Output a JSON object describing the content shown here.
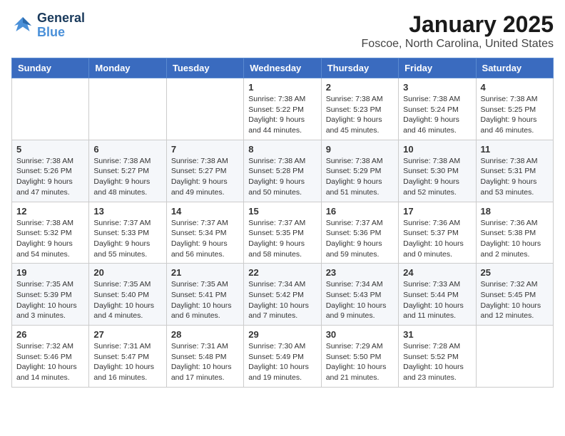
{
  "header": {
    "logo_line1": "General",
    "logo_line2": "Blue",
    "month_title": "January 2025",
    "location": "Foscoe, North Carolina, United States"
  },
  "days_of_week": [
    "Sunday",
    "Monday",
    "Tuesday",
    "Wednesday",
    "Thursday",
    "Friday",
    "Saturday"
  ],
  "weeks": [
    [
      {
        "day": "",
        "info": ""
      },
      {
        "day": "",
        "info": ""
      },
      {
        "day": "",
        "info": ""
      },
      {
        "day": "1",
        "info": "Sunrise: 7:38 AM\nSunset: 5:22 PM\nDaylight: 9 hours\nand 44 minutes."
      },
      {
        "day": "2",
        "info": "Sunrise: 7:38 AM\nSunset: 5:23 PM\nDaylight: 9 hours\nand 45 minutes."
      },
      {
        "day": "3",
        "info": "Sunrise: 7:38 AM\nSunset: 5:24 PM\nDaylight: 9 hours\nand 46 minutes."
      },
      {
        "day": "4",
        "info": "Sunrise: 7:38 AM\nSunset: 5:25 PM\nDaylight: 9 hours\nand 46 minutes."
      }
    ],
    [
      {
        "day": "5",
        "info": "Sunrise: 7:38 AM\nSunset: 5:26 PM\nDaylight: 9 hours\nand 47 minutes."
      },
      {
        "day": "6",
        "info": "Sunrise: 7:38 AM\nSunset: 5:27 PM\nDaylight: 9 hours\nand 48 minutes."
      },
      {
        "day": "7",
        "info": "Sunrise: 7:38 AM\nSunset: 5:27 PM\nDaylight: 9 hours\nand 49 minutes."
      },
      {
        "day": "8",
        "info": "Sunrise: 7:38 AM\nSunset: 5:28 PM\nDaylight: 9 hours\nand 50 minutes."
      },
      {
        "day": "9",
        "info": "Sunrise: 7:38 AM\nSunset: 5:29 PM\nDaylight: 9 hours\nand 51 minutes."
      },
      {
        "day": "10",
        "info": "Sunrise: 7:38 AM\nSunset: 5:30 PM\nDaylight: 9 hours\nand 52 minutes."
      },
      {
        "day": "11",
        "info": "Sunrise: 7:38 AM\nSunset: 5:31 PM\nDaylight: 9 hours\nand 53 minutes."
      }
    ],
    [
      {
        "day": "12",
        "info": "Sunrise: 7:38 AM\nSunset: 5:32 PM\nDaylight: 9 hours\nand 54 minutes."
      },
      {
        "day": "13",
        "info": "Sunrise: 7:37 AM\nSunset: 5:33 PM\nDaylight: 9 hours\nand 55 minutes."
      },
      {
        "day": "14",
        "info": "Sunrise: 7:37 AM\nSunset: 5:34 PM\nDaylight: 9 hours\nand 56 minutes."
      },
      {
        "day": "15",
        "info": "Sunrise: 7:37 AM\nSunset: 5:35 PM\nDaylight: 9 hours\nand 58 minutes."
      },
      {
        "day": "16",
        "info": "Sunrise: 7:37 AM\nSunset: 5:36 PM\nDaylight: 9 hours\nand 59 minutes."
      },
      {
        "day": "17",
        "info": "Sunrise: 7:36 AM\nSunset: 5:37 PM\nDaylight: 10 hours\nand 0 minutes."
      },
      {
        "day": "18",
        "info": "Sunrise: 7:36 AM\nSunset: 5:38 PM\nDaylight: 10 hours\nand 2 minutes."
      }
    ],
    [
      {
        "day": "19",
        "info": "Sunrise: 7:35 AM\nSunset: 5:39 PM\nDaylight: 10 hours\nand 3 minutes."
      },
      {
        "day": "20",
        "info": "Sunrise: 7:35 AM\nSunset: 5:40 PM\nDaylight: 10 hours\nand 4 minutes."
      },
      {
        "day": "21",
        "info": "Sunrise: 7:35 AM\nSunset: 5:41 PM\nDaylight: 10 hours\nand 6 minutes."
      },
      {
        "day": "22",
        "info": "Sunrise: 7:34 AM\nSunset: 5:42 PM\nDaylight: 10 hours\nand 7 minutes."
      },
      {
        "day": "23",
        "info": "Sunrise: 7:34 AM\nSunset: 5:43 PM\nDaylight: 10 hours\nand 9 minutes."
      },
      {
        "day": "24",
        "info": "Sunrise: 7:33 AM\nSunset: 5:44 PM\nDaylight: 10 hours\nand 11 minutes."
      },
      {
        "day": "25",
        "info": "Sunrise: 7:32 AM\nSunset: 5:45 PM\nDaylight: 10 hours\nand 12 minutes."
      }
    ],
    [
      {
        "day": "26",
        "info": "Sunrise: 7:32 AM\nSunset: 5:46 PM\nDaylight: 10 hours\nand 14 minutes."
      },
      {
        "day": "27",
        "info": "Sunrise: 7:31 AM\nSunset: 5:47 PM\nDaylight: 10 hours\nand 16 minutes."
      },
      {
        "day": "28",
        "info": "Sunrise: 7:31 AM\nSunset: 5:48 PM\nDaylight: 10 hours\nand 17 minutes."
      },
      {
        "day": "29",
        "info": "Sunrise: 7:30 AM\nSunset: 5:49 PM\nDaylight: 10 hours\nand 19 minutes."
      },
      {
        "day": "30",
        "info": "Sunrise: 7:29 AM\nSunset: 5:50 PM\nDaylight: 10 hours\nand 21 minutes."
      },
      {
        "day": "31",
        "info": "Sunrise: 7:28 AM\nSunset: 5:52 PM\nDaylight: 10 hours\nand 23 minutes."
      },
      {
        "day": "",
        "info": ""
      }
    ]
  ]
}
